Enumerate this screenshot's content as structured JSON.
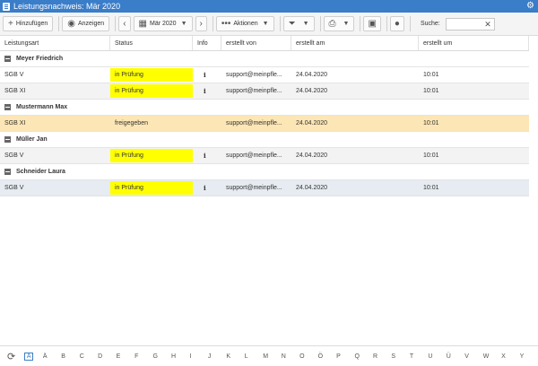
{
  "titlebar": {
    "title": "Leistungsnachweis: Mär 2020"
  },
  "toolbar": {
    "add_label": "Hinzufügen",
    "show_label": "Anzeigen",
    "period_label": "Mär 2020",
    "actions_label": "Aktionen",
    "search_label": "Suche:",
    "search_value": ""
  },
  "columns": [
    "Leistungsart",
    "Status",
    "Info",
    "erstellt von",
    "erstellt am",
    "erstellt um"
  ],
  "groups": [
    {
      "name": "Meyer Friedrich",
      "rows": [
        {
          "type": "SGB V",
          "status": "in Prüfung",
          "creator": "support@meinpfle...",
          "date": "24.04.2020",
          "time": "10:01"
        },
        {
          "type": "SGB XI",
          "status": "in Prüfung",
          "creator": "support@meinpfle...",
          "date": "24.04.2020",
          "time": "10:01"
        }
      ]
    },
    {
      "name": "Mustermann Max",
      "rows": [
        {
          "type": "SGB XI",
          "status": "freigegeben",
          "creator": "support@meinpfle...",
          "date": "24.04.2020",
          "time": "10:01"
        }
      ]
    },
    {
      "name": "Müller Jan",
      "rows": [
        {
          "type": "SGB V",
          "status": "in Prüfung",
          "creator": "support@meinpfle...",
          "date": "24.04.2020",
          "time": "10:01"
        }
      ]
    },
    {
      "name": "Schneider Laura",
      "rows": [
        {
          "type": "SGB V",
          "status": "in Prüfung",
          "creator": "support@meinpfle...",
          "date": "24.04.2020",
          "time": "10:01"
        }
      ]
    }
  ],
  "alphabet": [
    "A",
    "Ä",
    "B",
    "C",
    "D",
    "E",
    "F",
    "G",
    "H",
    "I",
    "J",
    "K",
    "L",
    "M",
    "N",
    "O",
    "Ö",
    "P",
    "Q",
    "R",
    "S",
    "T",
    "U",
    "Ü",
    "V",
    "W",
    "X",
    "Y"
  ],
  "active_letter": "A",
  "colors": {
    "titlebar": "#3a7dc9",
    "status_pending": "#ffff00",
    "selected_row": "#fce6b5"
  }
}
